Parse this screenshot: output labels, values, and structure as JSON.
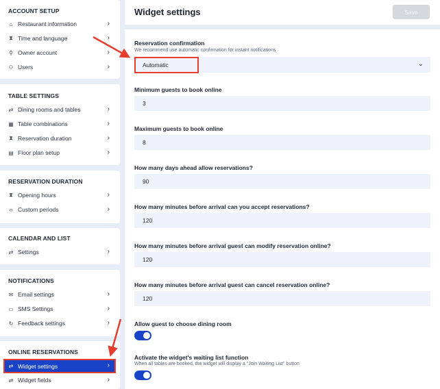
{
  "sidebar": {
    "sections": [
      {
        "title": "ACCOUNT SETUP",
        "items": [
          {
            "label": "Restaurant information",
            "icon": "home-icon"
          },
          {
            "label": "Time and language",
            "icon": "hourglass-icon"
          },
          {
            "label": "Owner account",
            "icon": "user-icon"
          },
          {
            "label": "Users",
            "icon": "users-icon"
          }
        ]
      },
      {
        "title": "TABLE SETTINGS",
        "items": [
          {
            "label": "Dining rooms and tables",
            "icon": "swap-icon"
          },
          {
            "label": "Table combinations",
            "icon": "grid-icon"
          },
          {
            "label": "Reservation duration",
            "icon": "hourglass-icon"
          },
          {
            "label": "Floor plan setup",
            "icon": "document-icon"
          }
        ]
      },
      {
        "title": "RESERVATION DURATION",
        "items": [
          {
            "label": "Opening hours",
            "icon": "hourglass-icon"
          },
          {
            "label": "Custom periods",
            "icon": "code-icon"
          }
        ]
      },
      {
        "title": "CALENDAR AND LIST",
        "items": [
          {
            "label": "Settings",
            "icon": "swap-icon"
          }
        ]
      },
      {
        "title": "NOTIFICATIONS",
        "items": [
          {
            "label": "Email settings",
            "icon": "mail-icon"
          },
          {
            "label": "SMS Settings",
            "icon": "sms-icon"
          },
          {
            "label": "Feedback settings",
            "icon": "refresh-icon"
          }
        ]
      },
      {
        "title": "ONLINE RESERVATIONS",
        "items": [
          {
            "label": "Widget settings",
            "icon": "swap-icon",
            "active": true
          },
          {
            "label": "Widget fields",
            "icon": "swap-icon"
          }
        ]
      }
    ]
  },
  "header": {
    "title": "Widget settings",
    "save_label": "Save"
  },
  "form": {
    "reservation_confirmation": {
      "label": "Reservation confirmation",
      "hint": "We recommend use automatic confirmation for instant notifications",
      "value": "Automatic"
    },
    "min_guests": {
      "label": "Minimum guests to book online",
      "value": "3"
    },
    "max_guests": {
      "label": "Maximum guests to book online",
      "value": "8"
    },
    "days_ahead": {
      "label": "How many days ahead allow reservations?",
      "value": "90"
    },
    "minutes_accept": {
      "label": "How many minutes before arrival can you accept reservations?",
      "value": "120"
    },
    "minutes_modify": {
      "label": "How many minutes before arrival guest can modify reservation online?",
      "value": "120"
    },
    "minutes_cancel": {
      "label": "How many minutes before arrival guest can cancel reservation online?",
      "value": "120"
    },
    "choose_dining_room": {
      "label": "Allow guest to choose dining room",
      "enabled": true
    },
    "waiting_list": {
      "label": "Activate the widget's waiting list function",
      "hint": "When all tables are booked, the widget will display a \"Join Waiting List\" button",
      "enabled": true
    }
  },
  "colors": {
    "accent": "#1843c8",
    "annotation": "#e53e2e",
    "background": "#e7edf6",
    "input_background": "#edf2fb"
  }
}
